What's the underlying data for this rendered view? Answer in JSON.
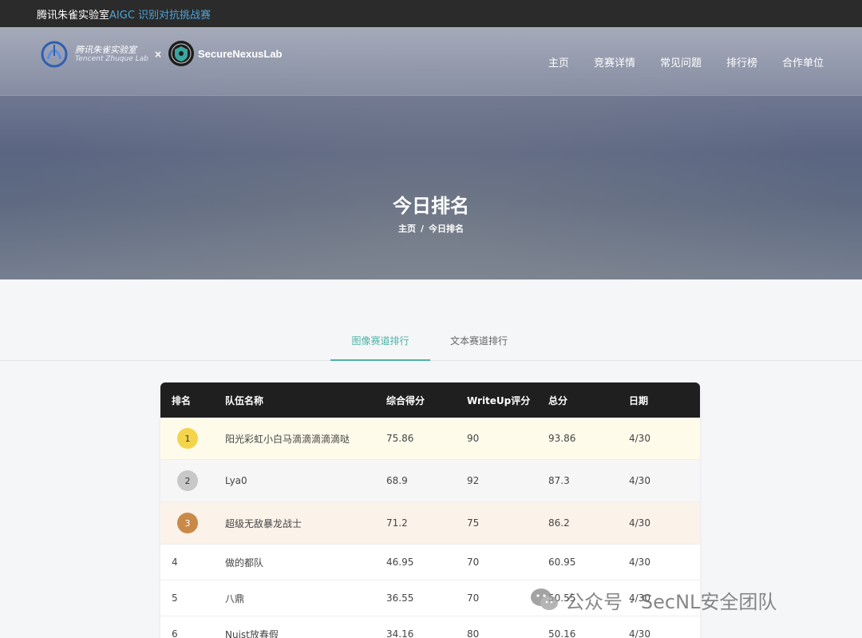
{
  "topbar": {
    "prefix": "腾讯朱雀实验室",
    "accent": "AIGC 识别对抗挑战赛"
  },
  "nav": {
    "logo1_cn": "腾讯朱雀实验室",
    "logo1_en": "Tencent Zhuque Lab",
    "times": "×",
    "logo2_name": "SecureNexusLab",
    "items": [
      {
        "label": "主页"
      },
      {
        "label": "竞赛详情"
      },
      {
        "label": "常见问题"
      },
      {
        "label": "排行榜"
      },
      {
        "label": "合作单位"
      }
    ]
  },
  "hero": {
    "title": "今日排名",
    "crumb_home": "主页",
    "crumb_sep": "/",
    "crumb_current": "今日排名"
  },
  "tabs": {
    "image": "图像赛道排行",
    "text": "文本赛道排行"
  },
  "table": {
    "headers": {
      "rank": "排名",
      "team": "队伍名称",
      "score": "综合得分",
      "writeup": "WriteUp评分",
      "total": "总分",
      "date": "日期"
    },
    "rows": [
      {
        "rank": "1",
        "team": "阳光彩虹小白马滴滴滴滴滴哒",
        "score": "75.86",
        "writeup": "90",
        "total": "93.86",
        "date": "4/30"
      },
      {
        "rank": "2",
        "team": "Lya0",
        "score": "68.9",
        "writeup": "92",
        "total": "87.3",
        "date": "4/30"
      },
      {
        "rank": "3",
        "team": "超级无敌暴龙战士",
        "score": "71.2",
        "writeup": "75",
        "total": "86.2",
        "date": "4/30"
      },
      {
        "rank": "4",
        "team": "做的都队",
        "score": "46.95",
        "writeup": "70",
        "total": "60.95",
        "date": "4/30"
      },
      {
        "rank": "5",
        "team": "八鼎",
        "score": "36.55",
        "writeup": "70",
        "total": "50.55",
        "date": "4/30"
      },
      {
        "rank": "6",
        "team": "Nuist放春假",
        "score": "34.16",
        "writeup": "80",
        "total": "50.16",
        "date": "4/30"
      }
    ]
  },
  "watermark": {
    "text": "公众号 · SecNL安全团队"
  },
  "colors": {
    "accent_teal": "#4cb3a6",
    "gold": "#f4d44a",
    "silver": "#c8c8c8",
    "bronze": "#c98a48",
    "header_dark": "#1f1f1f"
  }
}
